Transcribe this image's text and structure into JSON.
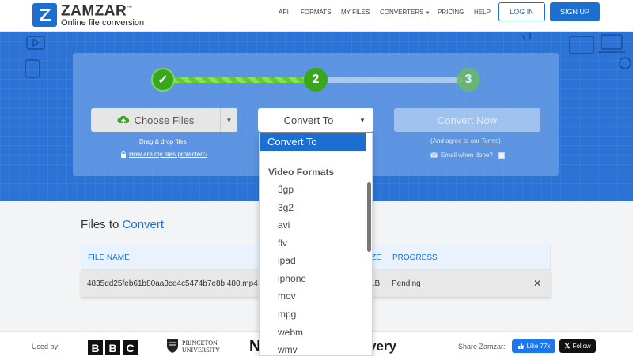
{
  "header": {
    "logo_name": "ZAMZAR",
    "logo_tm": "™",
    "logo_tagline": "Online file conversion",
    "nav": [
      "API",
      "FORMATS",
      "MY FILES",
      "CONVERTERS",
      "PRICING",
      "HELP"
    ],
    "login_label": "LOG IN",
    "signup_label": "SIGN UP"
  },
  "steps": {
    "step1": "✓",
    "step2": "2",
    "step3": "3"
  },
  "upload": {
    "choose_label": "Choose Files",
    "drag_text": "Drag & drop files",
    "protected_text": "How are my files protected?"
  },
  "convert": {
    "select_label": "Convert To",
    "convert_now_label": "Convert Now",
    "agree_prefix": "(And agree to our ",
    "agree_terms": "Terms",
    "agree_suffix": ")",
    "email_label": "Email when done?"
  },
  "dropdown": {
    "selected": "Convert To",
    "group_label": "Video Formats",
    "items": [
      "3gp",
      "3g2",
      "avi",
      "flv",
      "ipad",
      "iphone",
      "mov",
      "mpg",
      "webm",
      "wmv"
    ]
  },
  "files": {
    "title_prefix": "Files to ",
    "title_accent": "Convert",
    "col_name": "FILE NAME",
    "col_size": "ZE",
    "col_progress": "PROGRESS",
    "row": {
      "name": "4835dd25feb61b80aa3ce4c5474b7e8b.480.mp4",
      "size": "1B",
      "progress": "Pending"
    }
  },
  "footer": {
    "used_by": "Used by:",
    "bbc": [
      "B",
      "B",
      "C"
    ],
    "princeton_line1": "PRINCETON",
    "princeton_line2": "UNIVERSITY",
    "partial_logo_n": "N",
    "partial_logo_very": "very",
    "share_label": "Share Zamzar:",
    "like_label": "Like 77k",
    "follow_label": "Follow"
  },
  "colors": {
    "brand": "#1c6fd1",
    "hero": "#2b73d6",
    "step_green": "#3aa61b"
  }
}
